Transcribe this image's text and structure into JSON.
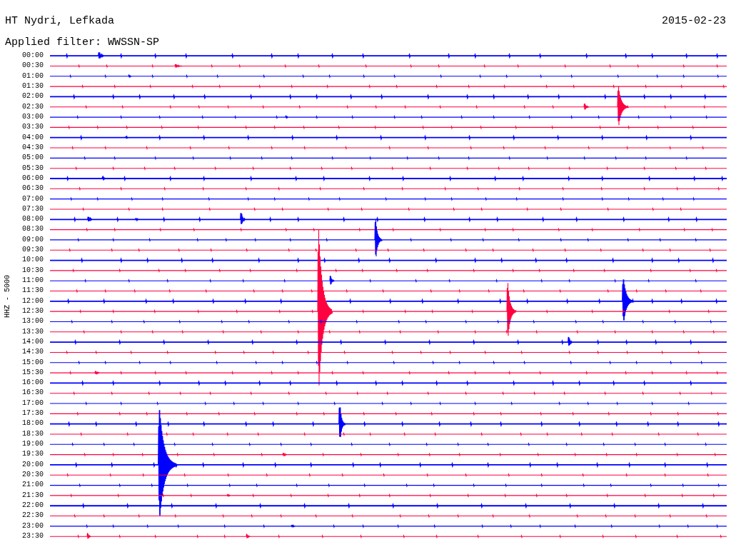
{
  "header": {
    "station": "HT Nydri, Lefkada",
    "date": "2015-02-23",
    "filter": "Applied filter: WWSSN-SP"
  },
  "helicorder": {
    "axis_label": "HHZ - 5000",
    "rows": [
      {
        "time": "00:00",
        "color": "#0000ff"
      },
      {
        "time": "00:30",
        "color": "#ff0040"
      },
      {
        "time": "01:00",
        "color": "#0000ff"
      },
      {
        "time": "01:30",
        "color": "#ff0040"
      },
      {
        "time": "02:00",
        "color": "#0000ff"
      },
      {
        "time": "02:30",
        "color": "#ff0040"
      },
      {
        "time": "03:00",
        "color": "#0000ff"
      },
      {
        "time": "03:30",
        "color": "#ff0040"
      },
      {
        "time": "04:00",
        "color": "#0000ff"
      },
      {
        "time": "04:30",
        "color": "#ff0040"
      },
      {
        "time": "05:00",
        "color": "#0000ff"
      },
      {
        "time": "05:30",
        "color": "#ff0040"
      },
      {
        "time": "06:00",
        "color": "#0000ff"
      },
      {
        "time": "06:30",
        "color": "#ff0040"
      },
      {
        "time": "07:00",
        "color": "#0000ff"
      },
      {
        "time": "07:30",
        "color": "#ff0040"
      },
      {
        "time": "08:00",
        "color": "#0000ff"
      },
      {
        "time": "08:30",
        "color": "#ff0040"
      },
      {
        "time": "09:00",
        "color": "#0000ff"
      },
      {
        "time": "09:30",
        "color": "#ff0040"
      },
      {
        "time": "10:00",
        "color": "#0000ff"
      },
      {
        "time": "10:30",
        "color": "#ff0040"
      },
      {
        "time": "11:00",
        "color": "#0000ff"
      },
      {
        "time": "11:30",
        "color": "#ff0040"
      },
      {
        "time": "12:00",
        "color": "#0000ff"
      },
      {
        "time": "12:30",
        "color": "#ff0040"
      },
      {
        "time": "13:00",
        "color": "#0000ff"
      },
      {
        "time": "13:30",
        "color": "#ff0040"
      },
      {
        "time": "14:00",
        "color": "#0000ff"
      },
      {
        "time": "14:30",
        "color": "#ff0040"
      },
      {
        "time": "15:00",
        "color": "#0000ff"
      },
      {
        "time": "15:30",
        "color": "#ff0040"
      },
      {
        "time": "16:00",
        "color": "#0000ff"
      },
      {
        "time": "16:30",
        "color": "#ff0040"
      },
      {
        "time": "17:00",
        "color": "#0000ff"
      },
      {
        "time": "17:30",
        "color": "#ff0040"
      },
      {
        "time": "18:00",
        "color": "#0000ff"
      },
      {
        "time": "18:30",
        "color": "#ff0040"
      },
      {
        "time": "19:00",
        "color": "#0000ff"
      },
      {
        "time": "19:30",
        "color": "#ff0040"
      },
      {
        "time": "20:00",
        "color": "#0000ff"
      },
      {
        "time": "20:30",
        "color": "#ff0040"
      },
      {
        "time": "21:00",
        "color": "#0000ff"
      },
      {
        "time": "21:30",
        "color": "#ff0040"
      },
      {
        "time": "22:00",
        "color": "#0000ff"
      },
      {
        "time": "22:30",
        "color": "#ff0040"
      },
      {
        "time": "23:00",
        "color": "#0000ff"
      },
      {
        "time": "23:30",
        "color": "#ff0040"
      }
    ]
  }
}
